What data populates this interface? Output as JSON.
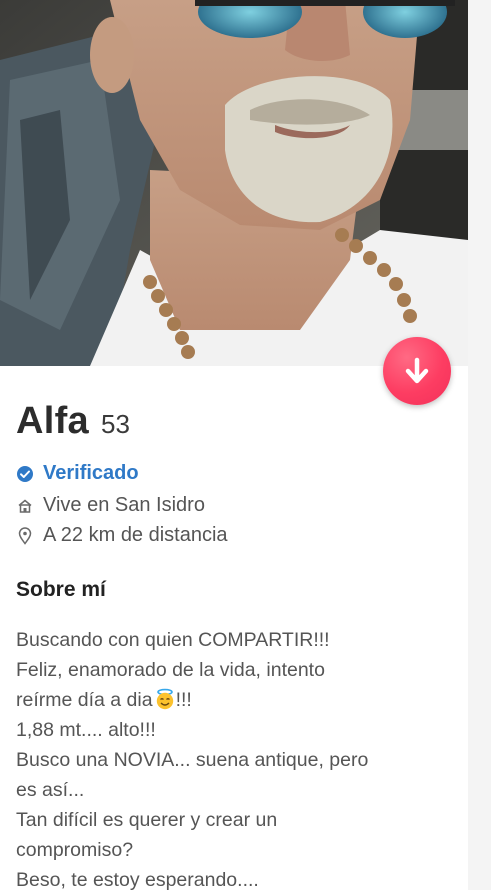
{
  "profile": {
    "name": "Alfa",
    "age": "53",
    "verified_label": "Verificado",
    "lives_in": "Vive en San Isidro",
    "distance": "A 22 km de distancia"
  },
  "about": {
    "title": "Sobre mí",
    "lines": [
      "Buscando con quien COMPARTIR!!!",
      "Feliz, enamorado de la vida, intento",
      "reírme día a dia",
      "!!!",
      "1,88 mt.... alto!!!",
      "Busco una NOVIA... suena antique, pero",
      "es así...",
      "Tan difícil es querer y crear un",
      "compromiso?",
      "Beso, te estoy esperando...."
    ]
  },
  "icons": {
    "fab": "arrow-down-icon",
    "verified": "verified-check-icon",
    "home": "home-icon",
    "location": "location-pin-icon",
    "emoji": "smiling-face-with-halo-emoji"
  },
  "colors": {
    "fab": "#fd3d62",
    "verified": "#2f79c7"
  }
}
